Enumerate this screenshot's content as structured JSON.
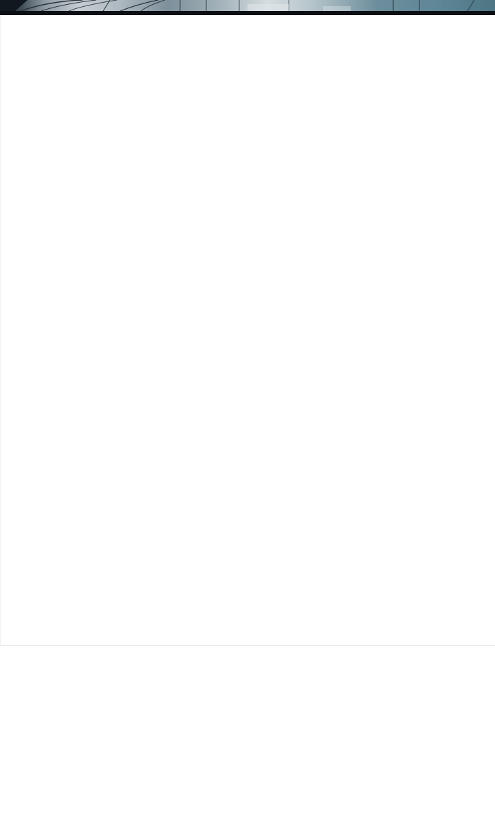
{
  "panel": {
    "colors": {
      "border": "#0c0f14",
      "tint_left": "#1d2a32",
      "tint_mid": "#d5dde0",
      "tint_right": "#4d7684"
    },
    "icon": "comic-panel-artwork"
  },
  "content": {
    "background": "#ffffff"
  }
}
